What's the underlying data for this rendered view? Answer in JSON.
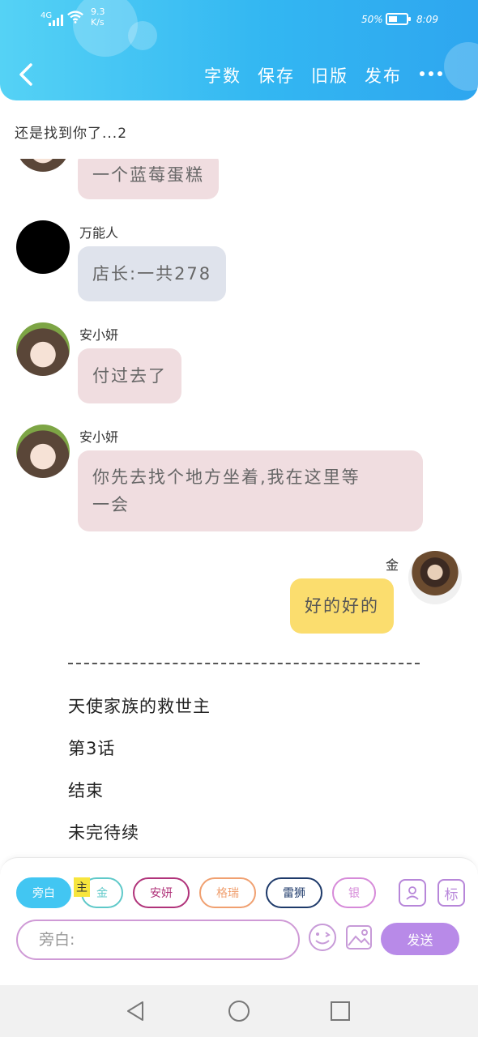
{
  "status_bar": {
    "network": "4G",
    "speed_value": "9.3",
    "speed_unit": "K/s",
    "battery_percent": "50%",
    "battery_level": 0.5,
    "time": "8:09"
  },
  "header": {
    "actions": [
      "字数",
      "保存",
      "旧版",
      "发布"
    ],
    "gradient_start": "#55d2f5",
    "gradient_end": "#2ea6ef"
  },
  "chapter_title": "还是找到你了...2",
  "messages": [
    {
      "sender": "",
      "text": "一个蓝莓蛋糕",
      "avatar": "girl",
      "side": "left",
      "color": "pink"
    },
    {
      "sender": "万能人",
      "text": "店长:一共278",
      "avatar": "black",
      "side": "left",
      "color": "gray"
    },
    {
      "sender": "安小妍",
      "text": "付过去了",
      "avatar": "girl",
      "side": "left",
      "color": "pink"
    },
    {
      "sender": "安小妍",
      "text_line1": "你先去找个地方坐着,我在这里等",
      "text_line2": "一会",
      "avatar": "girl",
      "side": "left",
      "color": "pink"
    },
    {
      "sender": "金",
      "text": "好的好的",
      "avatar": "boy",
      "side": "right",
      "color": "yellow"
    }
  ],
  "ending": {
    "divider": "------------------------------------------",
    "lines": [
      "天使家族的救世主",
      "第3话",
      "结束",
      "未完待续"
    ]
  },
  "composer": {
    "characters": [
      {
        "label": "旁白",
        "color": "#42c6f2",
        "active": true
      },
      {
        "label": "金",
        "color": "#5fc9c9",
        "active": false
      },
      {
        "label": "安妍",
        "color": "#b0337a",
        "active": false
      },
      {
        "label": "格瑞",
        "color": "#f0a070",
        "active": false
      },
      {
        "label": "雷狮",
        "color": "#1e3a6a",
        "active": false
      },
      {
        "label": "银",
        "color": "#d68ad9",
        "active": false
      }
    ],
    "protagonist_mark": "主",
    "tag_icon_label": "标",
    "input_placeholder": "旁白:",
    "send_label": "发送"
  },
  "icons": {
    "back": "chevron-left-icon",
    "more": "more-dots-icon",
    "contact": "person-card-icon",
    "tag": "tag-icon",
    "emoji": "smiley-icon",
    "image": "image-icon"
  }
}
